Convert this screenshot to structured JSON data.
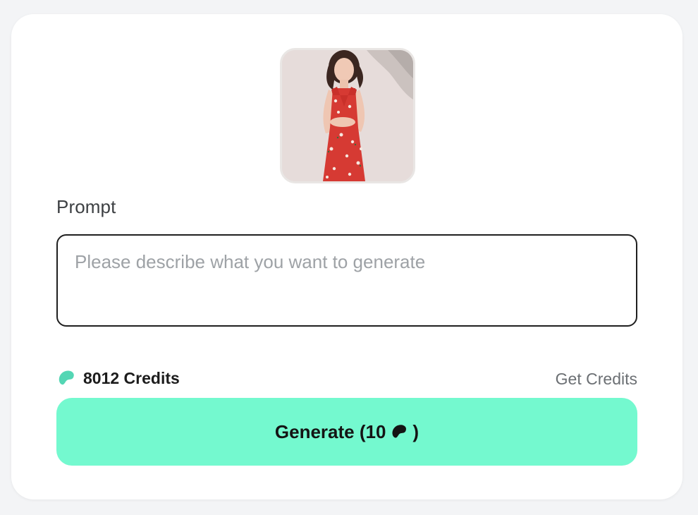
{
  "preview": {
    "image_alt": "woman in red floral dress"
  },
  "prompt": {
    "label": "Prompt",
    "placeholder": "Please describe what you want to generate",
    "value": ""
  },
  "credits": {
    "amount": "8012 Credits",
    "get_label": "Get Credits",
    "icon": "bean-icon"
  },
  "generate": {
    "label": "Generate (10",
    "close_paren": ")",
    "cost_icon": "bean-icon"
  },
  "colors": {
    "accent": "#74f9cf",
    "bean": "#54d6b4"
  }
}
